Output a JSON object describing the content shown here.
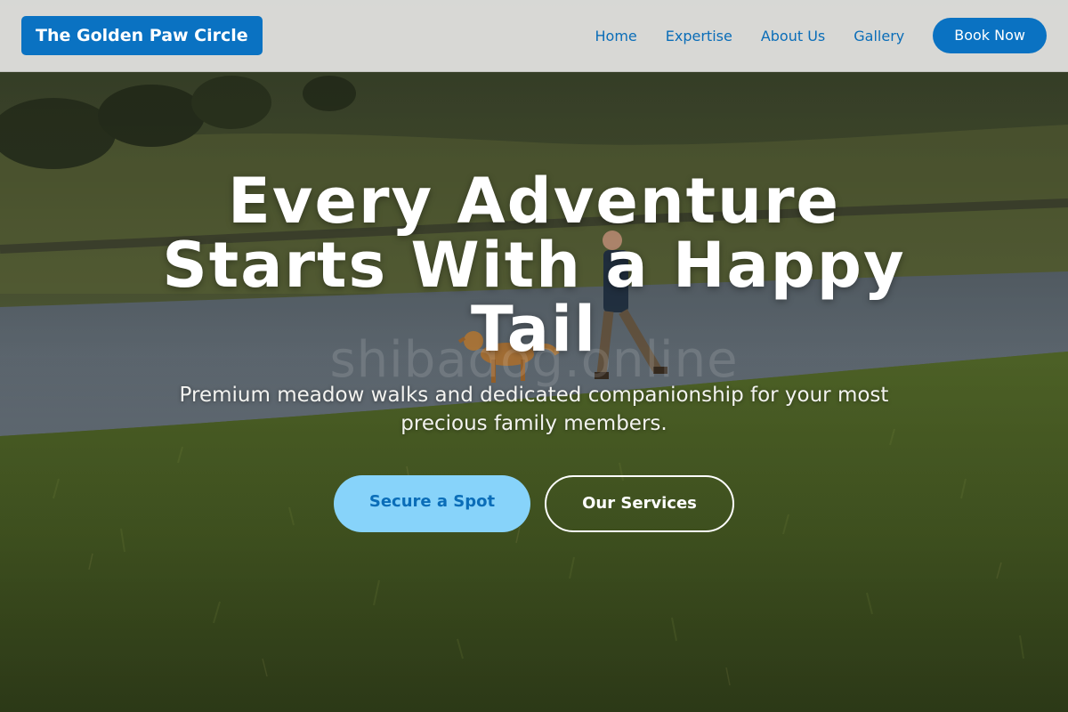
{
  "header": {
    "brand": "The Golden Paw Circle",
    "nav": {
      "home": "Home",
      "expertise": "Expertise",
      "about": "About Us",
      "gallery": "Gallery"
    },
    "book_now": "Book Now"
  },
  "hero": {
    "title": "Every Adventure Starts With a Happy Tail",
    "subtitle": "Premium meadow walks and dedicated companionship for your most precious family members.",
    "primary_cta": "Secure a Spot",
    "secondary_cta": "Our Services",
    "watermark": "shibadog.online"
  },
  "colors": {
    "brand_blue": "#0a72c2",
    "nav_text": "#0a6db8",
    "cta_light_blue": "#87d3fa"
  }
}
